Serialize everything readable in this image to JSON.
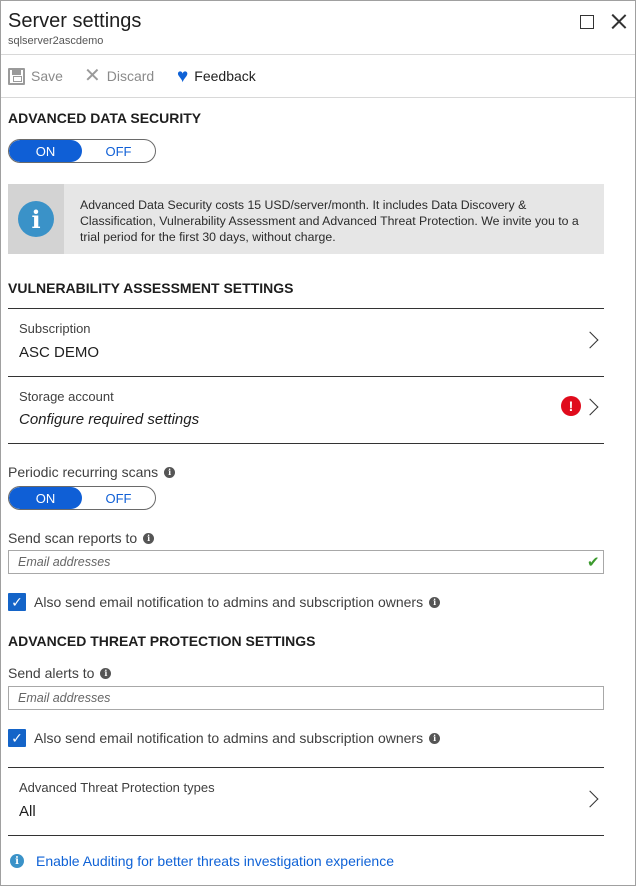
{
  "header": {
    "title": "Server settings",
    "subtitle": "sqlserver2ascdemo"
  },
  "toolbar": {
    "save_label": "Save",
    "discard_label": "Discard",
    "feedback_label": "Feedback"
  },
  "ads": {
    "heading": "ADVANCED DATA SECURITY",
    "toggle_on": "ON",
    "toggle_off": "OFF",
    "state": "ON",
    "info_text": "Advanced Data Security costs 15 USD/server/month. It includes Data Discovery & Classification, Vulnerability Assessment and Advanced Threat Protection. We invite you to a trial period for the first 30 days, without charge."
  },
  "va": {
    "heading": "VULNERABILITY ASSESSMENT SETTINGS",
    "subscription_label": "Subscription",
    "subscription_value": "ASC DEMO",
    "storage_label": "Storage account",
    "storage_value": "Configure required settings",
    "periodic_label": "Periodic recurring scans",
    "periodic_on": "ON",
    "periodic_off": "OFF",
    "periodic_state": "ON",
    "reports_label": "Send scan reports to",
    "reports_placeholder": "Email addresses",
    "reports_checkbox_label": "Also send email notification to admins and subscription owners"
  },
  "atp": {
    "heading": "ADVANCED THREAT PROTECTION SETTINGS",
    "alerts_label": "Send alerts to",
    "alerts_placeholder": "Email addresses",
    "alerts_checkbox_label": "Also send email notification to admins and subscription owners",
    "types_label": "Advanced Threat Protection types",
    "types_value": "All"
  },
  "footer": {
    "link_text": "Enable Auditing for better threats investigation experience"
  },
  "colors": {
    "accent": "#0f5fd6",
    "error": "#e00b1c",
    "success": "#3c9a2e",
    "info": "#3a92c8"
  }
}
